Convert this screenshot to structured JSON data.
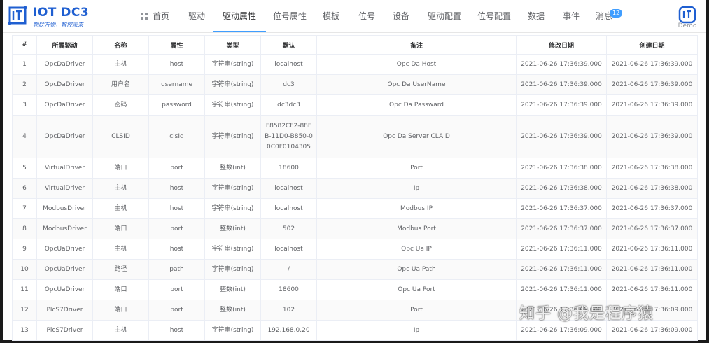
{
  "app": {
    "title": "IOT DC3",
    "slogan": "物联万物，智控未来",
    "demo_label": "Demo"
  },
  "nav": {
    "items": [
      "首页",
      "驱动",
      "驱动属性",
      "位号属性",
      "模板",
      "位号",
      "设备",
      "驱动配置",
      "位号配置",
      "数据",
      "事件",
      "消息"
    ],
    "active": "驱动属性",
    "message_count": "12"
  },
  "table": {
    "columns": [
      "#",
      "所属驱动",
      "名称",
      "属性",
      "类型",
      "默认",
      "备注",
      "修改日期",
      "创建日期"
    ],
    "rows": [
      [
        "1",
        "OpcDaDriver",
        "主机",
        "host",
        "字符串(string)",
        "localhost",
        "Opc Da Host",
        "2021-06-26 17:36:39.000",
        "2021-06-26 17:36:39.000"
      ],
      [
        "2",
        "OpcDaDriver",
        "用户名",
        "username",
        "字符串(string)",
        "dc3",
        "Opc Da UserName",
        "2021-06-26 17:36:39.000",
        "2021-06-26 17:36:39.000"
      ],
      [
        "3",
        "OpcDaDriver",
        "密码",
        "password",
        "字符串(string)",
        "dc3dc3",
        "Opc Da Passward",
        "2021-06-26 17:36:39.000",
        "2021-06-26 17:36:39.000"
      ],
      [
        "4",
        "OpcDaDriver",
        "CLSID",
        "clsId",
        "字符串(string)",
        "F8582CF2-88FB-11D0-B850-00C0F0104305",
        "Opc Da Server CLAID",
        "2021-06-26 17:36:39.000",
        "2021-06-26 17:36:39.000"
      ],
      [
        "5",
        "VirtualDriver",
        "端口",
        "port",
        "整数(int)",
        "18600",
        "Port",
        "2021-06-26 17:36:38.000",
        "2021-06-26 17:36:38.000"
      ],
      [
        "6",
        "VirtualDriver",
        "主机",
        "host",
        "字符串(string)",
        "localhost",
        "Ip",
        "2021-06-26 17:36:38.000",
        "2021-06-26 17:36:38.000"
      ],
      [
        "7",
        "ModbusDriver",
        "主机",
        "host",
        "字符串(string)",
        "localhost",
        "Modbus IP",
        "2021-06-26 17:36:37.000",
        "2021-06-26 17:36:37.000"
      ],
      [
        "8",
        "ModbusDriver",
        "端口",
        "port",
        "整数(int)",
        "502",
        "Modbus Port",
        "2021-06-26 17:36:37.000",
        "2021-06-26 17:36:37.000"
      ],
      [
        "9",
        "OpcUaDriver",
        "主机",
        "host",
        "字符串(string)",
        "localhost",
        "Opc Ua IP",
        "2021-06-26 17:36:11.000",
        "2021-06-26 17:36:11.000"
      ],
      [
        "10",
        "OpcUaDriver",
        "路径",
        "path",
        "字符串(string)",
        "/",
        "Opc Ua Path",
        "2021-06-26 17:36:11.000",
        "2021-06-26 17:36:11.000"
      ],
      [
        "11",
        "OpcUaDriver",
        "端口",
        "port",
        "整数(int)",
        "18600",
        "Opc Ua Port",
        "2021-06-26 17:36:11.000",
        "2021-06-26 17:36:11.000"
      ],
      [
        "12",
        "PlcS7Driver",
        "端口",
        "port",
        "整数(int)",
        "102",
        "Port",
        "2021-06-26 17:36:09.000",
        "2021-06-26 17:36:09.000"
      ],
      [
        "13",
        "PlcS7Driver",
        "主机",
        "host",
        "字符串(string)",
        "192.168.0.20",
        "Ip",
        "2021-06-26 17:36:09.000",
        "2021-06-26 17:36:09.000"
      ]
    ]
  },
  "watermark": "知乎 @我是程序猿",
  "colors": {
    "brand": "#1f5fd1",
    "accent": "#409eff",
    "border": "#ebeef5",
    "stripe": "#fafafa"
  }
}
